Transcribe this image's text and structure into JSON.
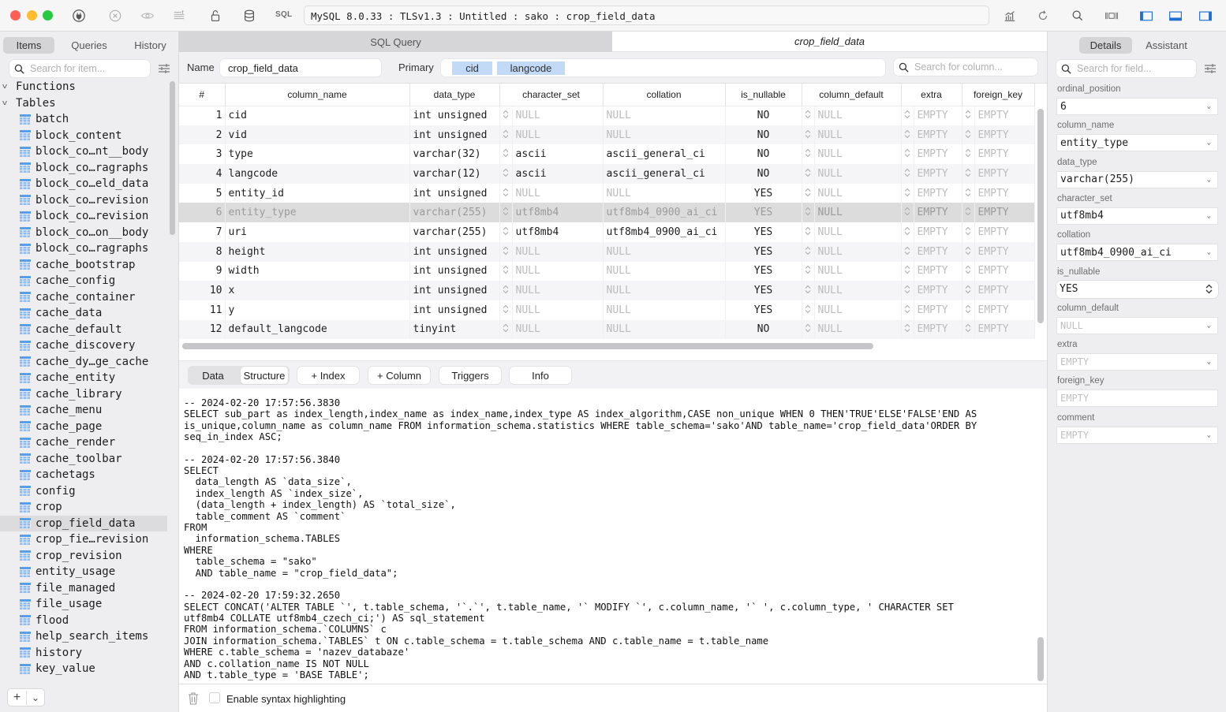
{
  "titlebar": {
    "connection": "MySQL 8.0.33 : TLSv1.3 : Untitled : sako : crop_field_data",
    "sql_label": "SQL",
    "traffic_lights": {
      "close": "#ff5f57",
      "minimize": "#febc2e",
      "zoom": "#28c840"
    },
    "left_icons": [
      "plug-icon",
      "close-circle-icon",
      "eye-icon",
      "text-align-icon",
      "lock-icon",
      "database-icon"
    ],
    "right_icons": [
      "chart-icon",
      "refresh-icon",
      "search-icon",
      "split-columns-icon",
      "toggle-left-panel-icon",
      "toggle-bottom-panel-icon",
      "toggle-right-panel-icon"
    ],
    "accent": "#1f6fd1"
  },
  "sidebar": {
    "tabs": [
      "Items",
      "Queries",
      "History"
    ],
    "active_tab": "Items",
    "search_placeholder": "Search for item...",
    "groups": [
      {
        "label": "Functions",
        "expanded": true
      },
      {
        "label": "Tables",
        "expanded": true
      }
    ],
    "tables": [
      "batch",
      "block_content",
      "block_co…nt__body",
      "block_co…ragraphs",
      "block_co…eld_data",
      "block_co…revision",
      "block_co…revision",
      "block_co…on__body",
      "block_co…ragraphs",
      "cache_bootstrap",
      "cache_config",
      "cache_container",
      "cache_data",
      "cache_default",
      "cache_discovery",
      "cache_dy…ge_cache",
      "cache_entity",
      "cache_library",
      "cache_menu",
      "cache_page",
      "cache_render",
      "cache_toolbar",
      "cachetags",
      "config",
      "crop",
      "crop_field_data",
      "crop_fie…revision",
      "crop_revision",
      "entity_usage",
      "file_managed",
      "file_usage",
      "flood",
      "help_search_items",
      "history",
      "key_value"
    ],
    "selected_table": "crop_field_data",
    "add_label": "+",
    "add_menu_label": "⌄"
  },
  "tabs": [
    {
      "label": "SQL Query",
      "active": false
    },
    {
      "label": "crop_field_data",
      "active": true
    }
  ],
  "props": {
    "name_label": "Name",
    "name_value": "crop_field_data",
    "primary_label": "Primary",
    "primary_keys": [
      "cid",
      "langcode"
    ],
    "column_search_placeholder": "Search for column..."
  },
  "grid": {
    "headers": [
      "#",
      "column_name",
      "data_type",
      "character_set",
      "collation",
      "is_nullable",
      "column_default",
      "extra",
      "foreign_key"
    ],
    "selected_row": 6,
    "rows": [
      {
        "n": "1",
        "name": "cid",
        "type": "int unsigned",
        "charset": "NULL",
        "collation": "NULL",
        "nullable": "NO",
        "default": "NULL",
        "extra": "EMPTY",
        "fk": "EMPTY"
      },
      {
        "n": "2",
        "name": "vid",
        "type": "int unsigned",
        "charset": "NULL",
        "collation": "NULL",
        "nullable": "NO",
        "default": "NULL",
        "extra": "EMPTY",
        "fk": "EMPTY"
      },
      {
        "n": "3",
        "name": "type",
        "type": "varchar(32)",
        "charset": "ascii",
        "collation": "ascii_general_ci",
        "nullable": "NO",
        "default": "NULL",
        "extra": "EMPTY",
        "fk": "EMPTY"
      },
      {
        "n": "4",
        "name": "langcode",
        "type": "varchar(12)",
        "charset": "ascii",
        "collation": "ascii_general_ci",
        "nullable": "NO",
        "default": "NULL",
        "extra": "EMPTY",
        "fk": "EMPTY"
      },
      {
        "n": "5",
        "name": "entity_id",
        "type": "int unsigned",
        "charset": "NULL",
        "collation": "NULL",
        "nullable": "YES",
        "default": "NULL",
        "extra": "EMPTY",
        "fk": "EMPTY"
      },
      {
        "n": "6",
        "name": "entity_type",
        "type": "varchar(255)",
        "charset": "utf8mb4",
        "collation": "utf8mb4_0900_ai_ci",
        "nullable": "YES",
        "default": "NULL",
        "extra": "EMPTY",
        "fk": "EMPTY"
      },
      {
        "n": "7",
        "name": "uri",
        "type": "varchar(255)",
        "charset": "utf8mb4",
        "collation": "utf8mb4_0900_ai_ci",
        "nullable": "YES",
        "default": "NULL",
        "extra": "EMPTY",
        "fk": "EMPTY"
      },
      {
        "n": "8",
        "name": "height",
        "type": "int unsigned",
        "charset": "NULL",
        "collation": "NULL",
        "nullable": "YES",
        "default": "NULL",
        "extra": "EMPTY",
        "fk": "EMPTY"
      },
      {
        "n": "9",
        "name": "width",
        "type": "int unsigned",
        "charset": "NULL",
        "collation": "NULL",
        "nullable": "YES",
        "default": "NULL",
        "extra": "EMPTY",
        "fk": "EMPTY"
      },
      {
        "n": "10",
        "name": "x",
        "type": "int unsigned",
        "charset": "NULL",
        "collation": "NULL",
        "nullable": "YES",
        "default": "NULL",
        "extra": "EMPTY",
        "fk": "EMPTY"
      },
      {
        "n": "11",
        "name": "y",
        "type": "int unsigned",
        "charset": "NULL",
        "collation": "NULL",
        "nullable": "YES",
        "default": "NULL",
        "extra": "EMPTY",
        "fk": "EMPTY"
      },
      {
        "n": "12",
        "name": "default_langcode",
        "type": "tinyint",
        "charset": "NULL",
        "collation": "NULL",
        "nullable": "NO",
        "default": "NULL",
        "extra": "EMPTY",
        "fk": "EMPTY"
      }
    ]
  },
  "panel_tabs": {
    "data": "Data",
    "structure": "Structure",
    "index": "+  Index",
    "column": "+ Column",
    "triggers": "Triggers",
    "info": "Info",
    "active": "Structure"
  },
  "log": {
    "entries": [
      "-- 2024-02-20 17:57:56.3830\nSELECT sub_part as index_length,index_name as index_name,index_type AS index_algorithm,CASE non_unique WHEN 0 THEN'TRUE'ELSE'FALSE'END AS\nis_unique,column_name as column_name FROM information_schema.statistics WHERE table_schema='sako'AND table_name='crop_field_data'ORDER BY\nseq_in_index ASC;",
      "-- 2024-02-20 17:57:56.3840\nSELECT\n  data_length AS `data_size`,\n  index_length AS `index_size`,\n  (data_length + index_length) AS `total_size`,\n  table_comment AS `comment`\nFROM\n  information_schema.TABLES\nWHERE\n  table_schema = \"sako\"\n  AND table_name = \"crop_field_data\";",
      "-- 2024-02-20 17:59:32.2650\nSELECT CONCAT('ALTER TABLE `', t.table_schema, '`.`', t.table_name, '` MODIFY `', c.column_name, '` ', c.column_type, ' CHARACTER SET\nutf8mb4 COLLATE utf8mb4_czech_ci;') AS sql_statement\nFROM information_schema.`COLUMNS` c\nJOIN information_schema.`TABLES` t ON c.table_schema = t.table_schema AND c.table_name = t.table_name\nWHERE c.table_schema = 'nazev_databaze'\nAND c.collation_name IS NOT NULL\nAND t.table_type = 'BASE TABLE';"
    ]
  },
  "footer": {
    "syntax_highlight_label": "Enable syntax highlighting",
    "syntax_highlight_checked": false
  },
  "details": {
    "tabs": [
      "Details",
      "Assistant"
    ],
    "active_tab": "Details",
    "search_placeholder": "Search for field...",
    "fields": [
      {
        "label": "ordinal_position",
        "value": "6",
        "muted": false,
        "control": "dropdown"
      },
      {
        "label": "column_name",
        "value": "entity_type",
        "muted": false,
        "control": "dropdown"
      },
      {
        "label": "data_type",
        "value": "varchar(255)",
        "muted": false,
        "control": "dropdown"
      },
      {
        "label": "character_set",
        "value": "utf8mb4",
        "muted": false,
        "control": "dropdown"
      },
      {
        "label": "collation",
        "value": "utf8mb4_0900_ai_ci",
        "muted": false,
        "control": "dropdown"
      },
      {
        "label": "is_nullable",
        "value": "YES",
        "muted": false,
        "control": "popup"
      },
      {
        "label": "column_default",
        "value": "NULL",
        "muted": true,
        "control": "dropdown"
      },
      {
        "label": "extra",
        "value": "EMPTY",
        "muted": true,
        "control": "dropdown"
      },
      {
        "label": "foreign_key",
        "value": "EMPTY",
        "muted": true,
        "control": "text"
      },
      {
        "label": "comment",
        "value": "EMPTY",
        "muted": true,
        "control": "dropdown"
      }
    ]
  }
}
